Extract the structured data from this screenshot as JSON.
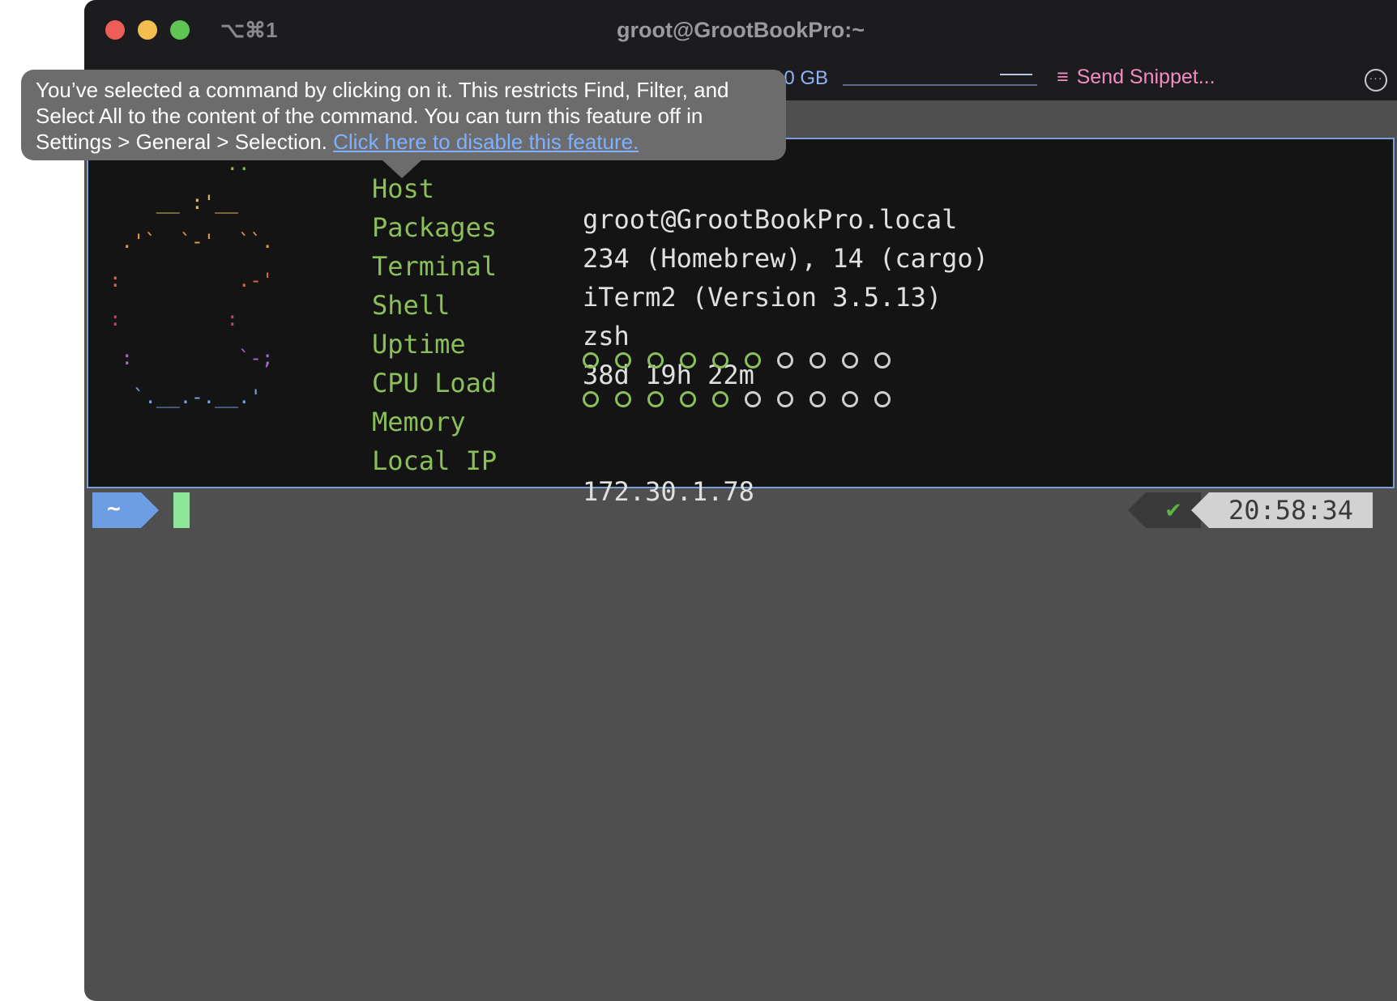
{
  "window": {
    "shortcut": "⌥⌘1",
    "title": "groot@GrootBookPro:~"
  },
  "statusbar": {
    "memory_text": "10 GB",
    "snippet_icon": "≡",
    "snippet_label": "Send Snippet...",
    "more_icon": "···"
  },
  "tooltip": {
    "message": "You’ve selected a command by clicking on it. This restricts Find, Filter, and Select All to the content of the command. You can turn this feature off in Settings > General > Selection.",
    "link": "Click here to disable this feature."
  },
  "sysinfo": [
    {
      "label": "Host",
      "value": "groot@GrootBookPro.local"
    },
    {
      "label": "Packages",
      "value": "234 (Homebrew), 14 (cargo)"
    },
    {
      "label": "Terminal",
      "value": "iTerm2 (Version 3.5.13)"
    },
    {
      "label": "Shell",
      "value": "zsh"
    },
    {
      "label": "Uptime",
      "value": "38d 19h 22m"
    },
    {
      "label": "CPU Load",
      "level": 6,
      "total": 10
    },
    {
      "label": "Memory",
      "level": 5,
      "total": 10
    },
    {
      "label": "Local IP",
      "value": "172.30.1.78"
    }
  ],
  "logo_lines": [
    {
      "text": "          ..",
      "color": "c1"
    },
    {
      "text": "    __ :'__",
      "color": "c2"
    },
    {
      "text": " .'`  `-'  ``.",
      "color": "c3"
    },
    {
      "text": ":          .-'",
      "color": "c4"
    },
    {
      "text": ":         :",
      "color": "c5"
    },
    {
      "text": " :         `-;",
      "color": "c6"
    },
    {
      "text": "  `.__.-.__.'",
      "color": "c7"
    }
  ],
  "prompt": {
    "dir": "~",
    "status_icon": "✔",
    "time": "20:58:34"
  },
  "colors": {
    "accent_green": "#8bbf5a",
    "prompt_blue": "#6d9de3",
    "snippet_pink": "#f28dbf",
    "link_blue": "#7eb1ff"
  }
}
